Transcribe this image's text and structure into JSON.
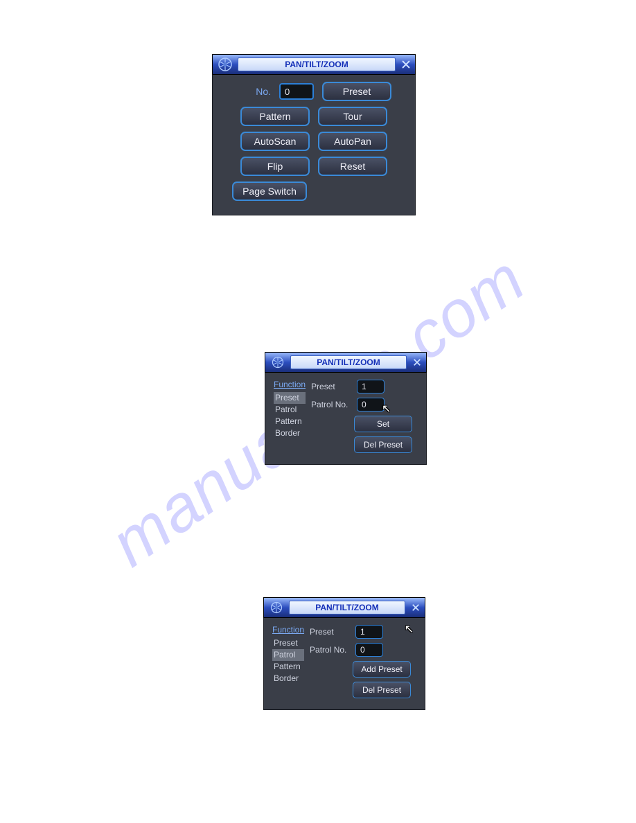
{
  "title": "PAN/TILT/ZOOM",
  "panel1": {
    "no_label": "No.",
    "no_value": "0",
    "buttons": {
      "preset": "Preset",
      "pattern": "Pattern",
      "tour": "Tour",
      "autoscan": "AutoScan",
      "autopan": "AutoPan",
      "flip": "Flip",
      "reset": "Reset",
      "page_switch": "Page Switch"
    }
  },
  "function_label": "Function",
  "functions": {
    "preset": "Preset",
    "patrol": "Patrol",
    "pattern": "Pattern",
    "border": "Border"
  },
  "fields": {
    "preset_label": "Preset",
    "patrol_label": "Patrol No."
  },
  "panel2": {
    "selected": "Preset",
    "preset_value": "1",
    "patrol_value": "0",
    "btn1": "Set",
    "btn2": "Del Preset"
  },
  "panel3": {
    "selected": "Patrol",
    "preset_value": "1",
    "patrol_value": "0",
    "btn1": "Add Preset",
    "btn2": "Del Preset"
  }
}
